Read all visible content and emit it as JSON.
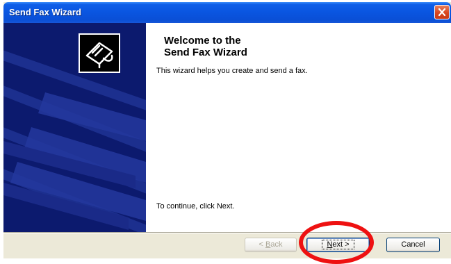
{
  "window": {
    "title": "Send Fax Wizard",
    "titlebar_color": "#0a55e0",
    "close_icon": "close-icon"
  },
  "side_panel": {
    "background_color": "#0c1a6e",
    "icon": "fax-machine-icon"
  },
  "welcome": {
    "heading": "Welcome to the\nSend Fax Wizard",
    "description": "This wizard helps you create and send a fax.",
    "continue_instruction": "To continue, click Next."
  },
  "buttons": {
    "back": {
      "prefix": "< ",
      "access_key": "B",
      "rest": "ack",
      "enabled": false
    },
    "next": {
      "access_key": "N",
      "rest": "ext >",
      "enabled": true,
      "default": true
    },
    "cancel": {
      "label": "Cancel",
      "enabled": true
    }
  },
  "annotation": {
    "highlight_color": "#ee1111",
    "target": "next-button"
  }
}
